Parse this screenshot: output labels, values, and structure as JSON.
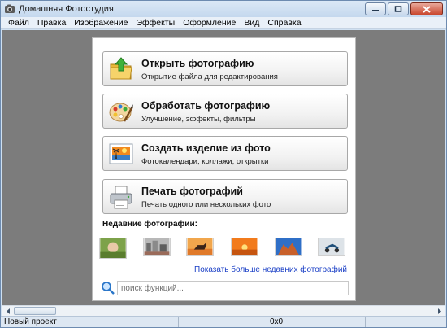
{
  "window": {
    "title": "Домашняя Фотостудия"
  },
  "menu": [
    "Файл",
    "Правка",
    "Изображение",
    "Эффекты",
    "Оформление",
    "Вид",
    "Справка"
  ],
  "actions": [
    {
      "title": "Открыть фотографию",
      "desc": "Открытие файла для редактирования",
      "icon": "open-folder-icon"
    },
    {
      "title": "Обработать фотографию",
      "desc": "Улучшение, эффекты, фильтры",
      "icon": "palette-icon"
    },
    {
      "title": "Создать изделие из фото",
      "desc": "Фотокалендари, коллажи, открытки",
      "icon": "photo-product-icon"
    },
    {
      "title": "Печать фотографий",
      "desc": "Печать одного или нескольких фото",
      "icon": "printer-icon"
    }
  ],
  "recent": {
    "label": "Недавние фотографии:",
    "thumbnails": [
      "garden-photo",
      "city-photo",
      "horse-photo",
      "sunset-photo",
      "desert-photo",
      "scooter-photo"
    ],
    "more_link": "Показать больше недавних фотографий"
  },
  "search": {
    "placeholder": "поиск функций..."
  },
  "status": {
    "left": "Новый проект",
    "size": "0x0"
  },
  "colors": {
    "canvas": "#7c7c7c",
    "link": "#1a3fc6",
    "titlebar": "#c4d8ee"
  }
}
